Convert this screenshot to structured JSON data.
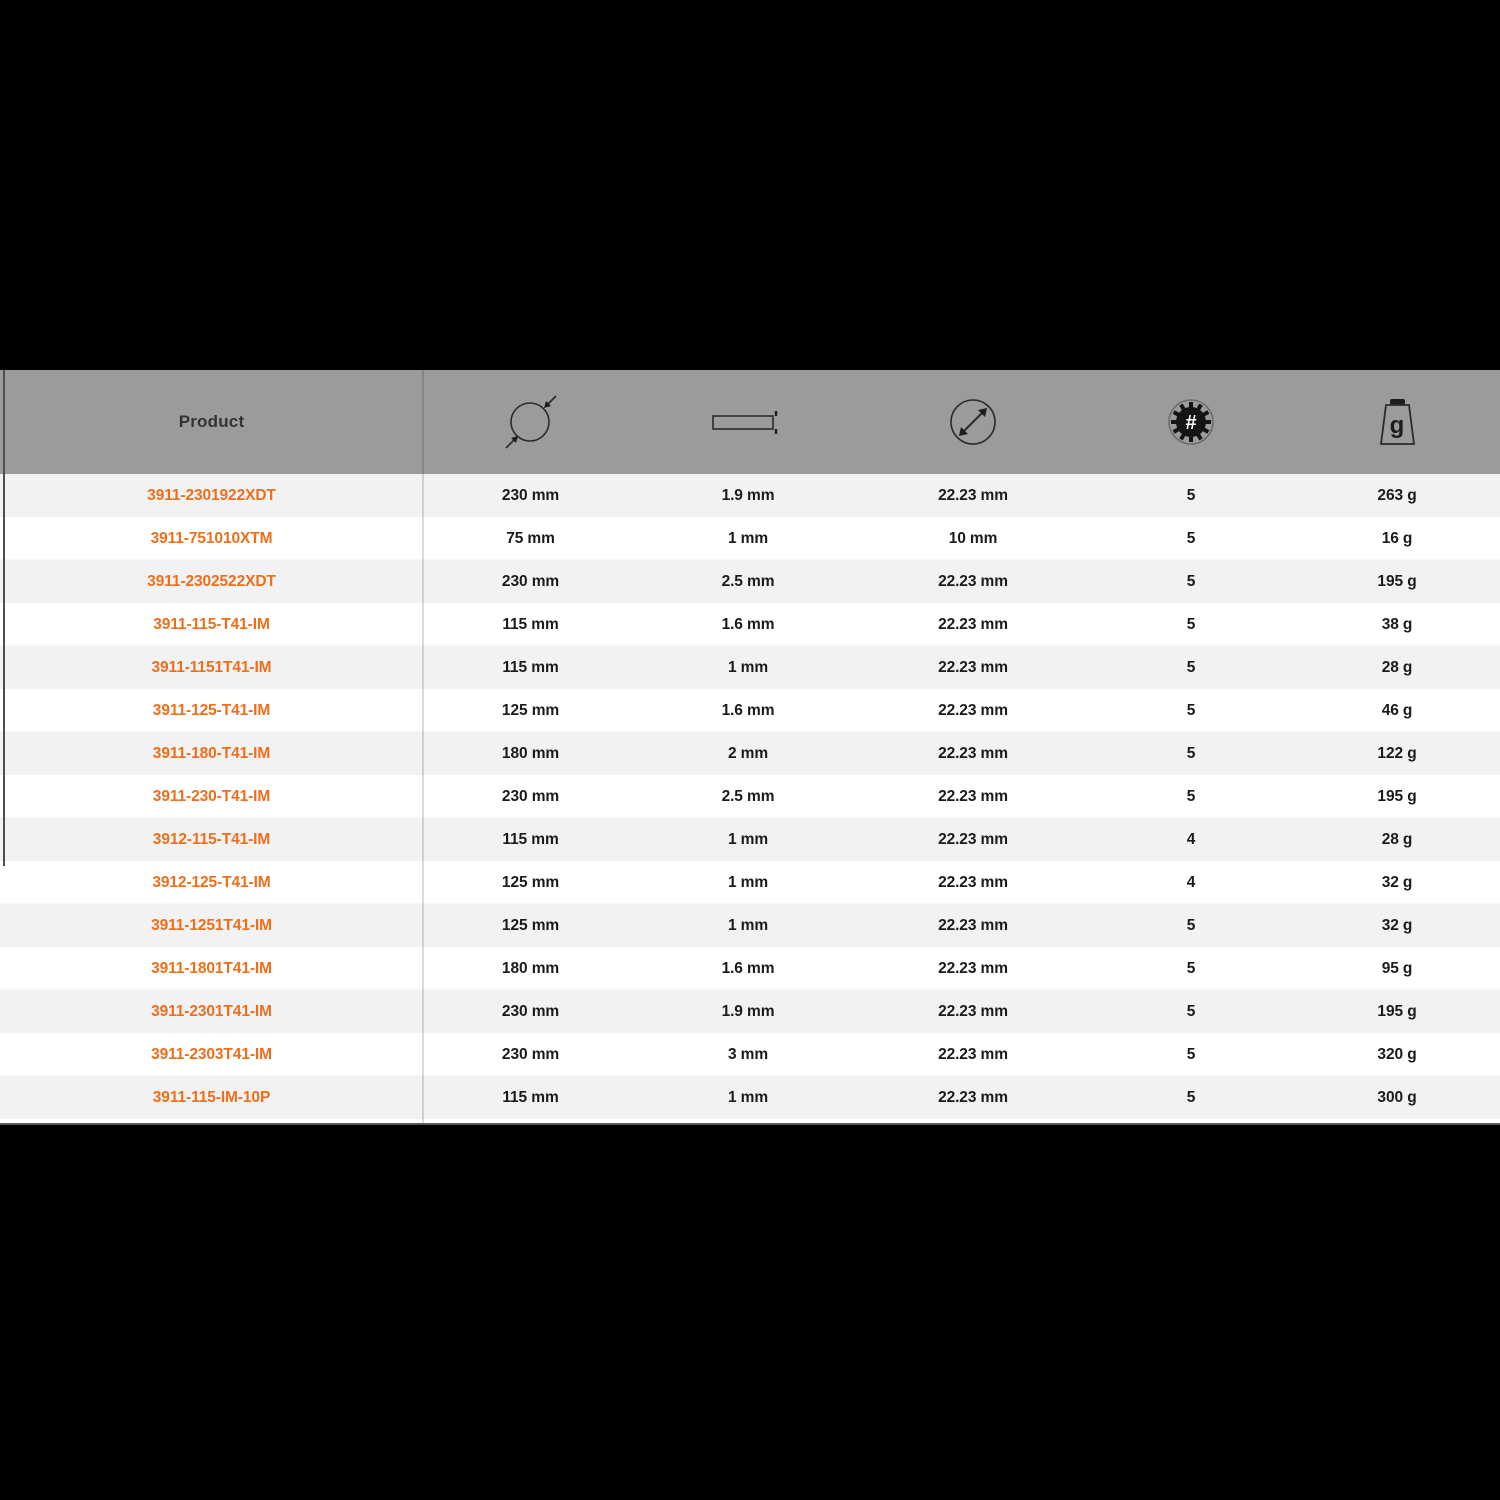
{
  "table": {
    "header": {
      "product_label": "Product",
      "columns": [
        {
          "key": "product",
          "label": "Product",
          "icon": "none"
        },
        {
          "key": "diameter",
          "label": "",
          "icon": "outer-diameter-icon"
        },
        {
          "key": "thickness",
          "label": "",
          "icon": "thickness-icon"
        },
        {
          "key": "bore",
          "label": "",
          "icon": "bore-diameter-icon"
        },
        {
          "key": "quantity",
          "label": "",
          "icon": "quantity-hash-icon"
        },
        {
          "key": "weight",
          "label": "g",
          "icon": "weight-gram-icon"
        }
      ]
    },
    "rows": [
      {
        "product": "3911-2301922XDT",
        "diameter": "230 mm",
        "thickness": "1.9 mm",
        "bore": "22.23 mm",
        "quantity": "5",
        "weight": "263 g"
      },
      {
        "product": "3911-751010XTM",
        "diameter": "75 mm",
        "thickness": "1 mm",
        "bore": "10 mm",
        "quantity": "5",
        "weight": "16 g"
      },
      {
        "product": "3911-2302522XDT",
        "diameter": "230 mm",
        "thickness": "2.5 mm",
        "bore": "22.23 mm",
        "quantity": "5",
        "weight": "195 g"
      },
      {
        "product": "3911-115-T41-IM",
        "diameter": "115 mm",
        "thickness": "1.6 mm",
        "bore": "22.23 mm",
        "quantity": "5",
        "weight": "38 g"
      },
      {
        "product": "3911-1151T41-IM",
        "diameter": "115 mm",
        "thickness": "1 mm",
        "bore": "22.23 mm",
        "quantity": "5",
        "weight": "28 g"
      },
      {
        "product": "3911-125-T41-IM",
        "diameter": "125 mm",
        "thickness": "1.6 mm",
        "bore": "22.23 mm",
        "quantity": "5",
        "weight": "46 g"
      },
      {
        "product": "3911-180-T41-IM",
        "diameter": "180 mm",
        "thickness": "2 mm",
        "bore": "22.23 mm",
        "quantity": "5",
        "weight": "122 g"
      },
      {
        "product": "3911-230-T41-IM",
        "diameter": "230 mm",
        "thickness": "2.5 mm",
        "bore": "22.23 mm",
        "quantity": "5",
        "weight": "195 g"
      },
      {
        "product": "3912-115-T41-IM",
        "diameter": "115 mm",
        "thickness": "1 mm",
        "bore": "22.23 mm",
        "quantity": "4",
        "weight": "28 g"
      },
      {
        "product": "3912-125-T41-IM",
        "diameter": "125 mm",
        "thickness": "1 mm",
        "bore": "22.23 mm",
        "quantity": "4",
        "weight": "32 g"
      },
      {
        "product": "3911-1251T41-IM",
        "diameter": "125 mm",
        "thickness": "1 mm",
        "bore": "22.23 mm",
        "quantity": "5",
        "weight": "32 g"
      },
      {
        "product": "3911-1801T41-IM",
        "diameter": "180 mm",
        "thickness": "1.6 mm",
        "bore": "22.23 mm",
        "quantity": "5",
        "weight": "95 g"
      },
      {
        "product": "3911-2301T41-IM",
        "diameter": "230 mm",
        "thickness": "1.9 mm",
        "bore": "22.23 mm",
        "quantity": "5",
        "weight": "195 g"
      },
      {
        "product": "3911-2303T41-IM",
        "diameter": "230 mm",
        "thickness": "3 mm",
        "bore": "22.23 mm",
        "quantity": "5",
        "weight": "320 g"
      },
      {
        "product": "3911-115-IM-10P",
        "diameter": "115 mm",
        "thickness": "1 mm",
        "bore": "22.23 mm",
        "quantity": "5",
        "weight": "300 g"
      }
    ]
  },
  "colors": {
    "header_background": "#9b9b9b",
    "product_link": "#ee6e1b",
    "row_odd": "#f2f2f2",
    "row_even": "#ffffff",
    "text": "#1b1b1b",
    "page_background": "#000000"
  },
  "icon_glyphs": {
    "weight_unit": "g",
    "quantity_symbol": "#"
  }
}
